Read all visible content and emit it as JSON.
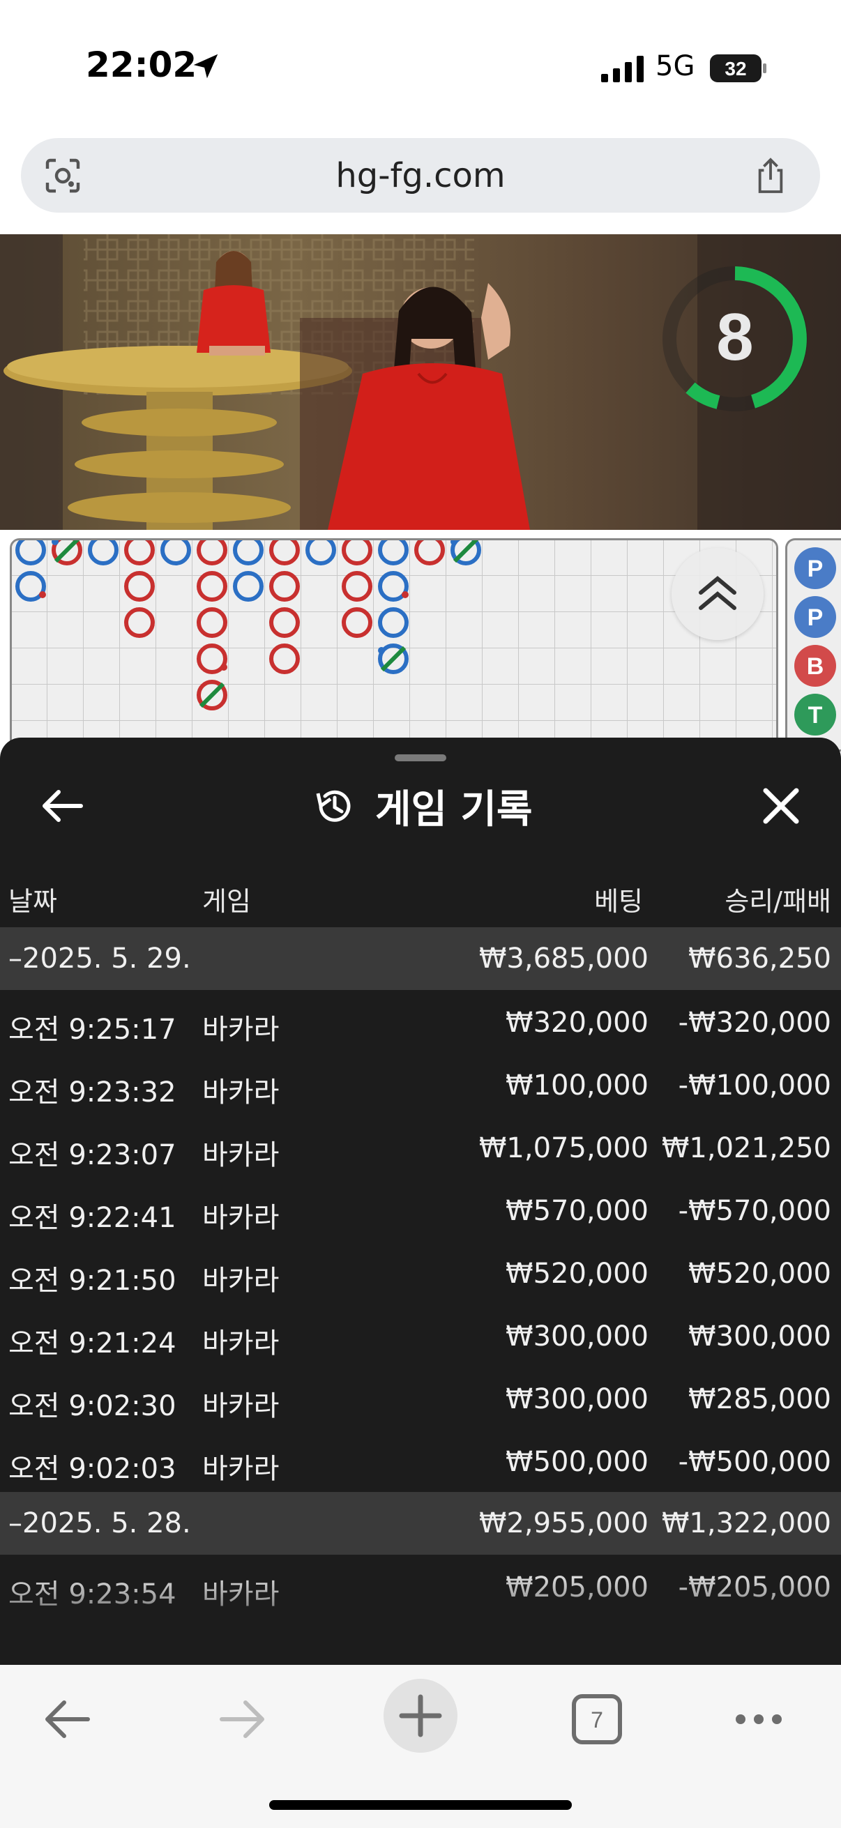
{
  "status_bar": {
    "time": "22:02",
    "network": "5G",
    "battery": "32"
  },
  "url_bar": {
    "url": "hg-fg.com"
  },
  "video": {
    "countdown": "8"
  },
  "sheet": {
    "title": "게임 기록",
    "columns": {
      "date": "날짜",
      "game": "게임",
      "bet": "베팅",
      "result": "승리/패배"
    },
    "groups": [
      {
        "date": "–2025. 5. 29.",
        "total_bet": "₩3,685,000",
        "total_result": "₩636,250",
        "rows": [
          {
            "time": "오전 9:25:17",
            "game": "바카라",
            "bet": "₩320,000",
            "result": "-₩320,000"
          },
          {
            "time": "오전 9:23:32",
            "game": "바카라",
            "bet": "₩100,000",
            "result": "-₩100,000"
          },
          {
            "time": "오전 9:23:07",
            "game": "바카라",
            "bet": "₩1,075,000",
            "result": "₩1,021,250"
          },
          {
            "time": "오전 9:22:41",
            "game": "바카라",
            "bet": "₩570,000",
            "result": "-₩570,000"
          },
          {
            "time": "오전 9:21:50",
            "game": "바카라",
            "bet": "₩520,000",
            "result": "₩520,000"
          },
          {
            "time": "오전 9:21:24",
            "game": "바카라",
            "bet": "₩300,000",
            "result": "₩300,000"
          },
          {
            "time": "오전 9:02:30",
            "game": "바카라",
            "bet": "₩300,000",
            "result": "₩285,000"
          },
          {
            "time": "오전 9:02:03",
            "game": "바카라",
            "bet": "₩500,000",
            "result": "-₩500,000"
          }
        ]
      },
      {
        "date": "–2025. 5. 28.",
        "total_bet": "₩2,955,000",
        "total_result": "₩1,322,000",
        "rows": [
          {
            "time": "오전 9:23:54",
            "game": "바카라",
            "bet": "₩205,000",
            "result": "-₩205,000"
          }
        ]
      }
    ]
  },
  "side_panel": {
    "labels": [
      "P",
      "P",
      "B",
      "T"
    ]
  },
  "toolbar": {
    "tab_count": "7"
  },
  "colors": {
    "player_blue": "#2b6fc4",
    "banker_red": "#c8302f",
    "tie_green": "#1e8a3e",
    "timer_green": "#1db954"
  }
}
